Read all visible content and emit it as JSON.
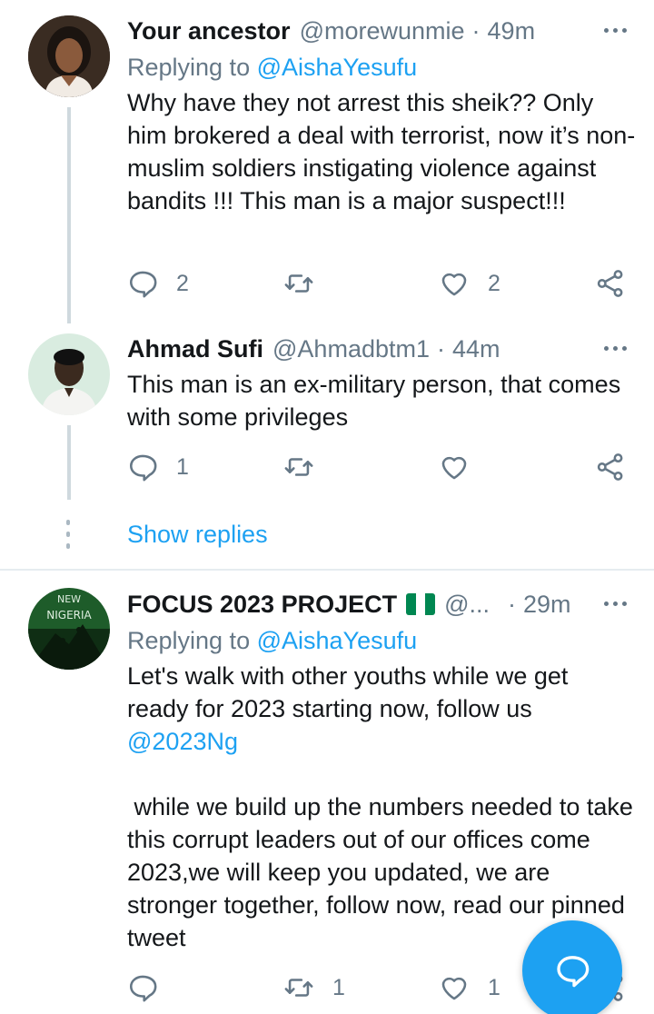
{
  "tweets": [
    {
      "name": "Your ancestor",
      "handle": "@morewunmie",
      "time": "49m",
      "replying_label": "Replying to",
      "replying_to": "@AishaYesufu",
      "text": "Why have they not arrest this sheik?? Only him brokered a deal with terrorist, now it’s non-muslim soldiers instigating violence against bandits !!! This man is a major suspect!!!",
      "reply_count": "2",
      "retweet_count": "",
      "like_count": "2"
    },
    {
      "name": "Ahmad Sufi",
      "handle": "@Ahmadbtm1",
      "time": "44m",
      "text": "This man is an ex-military person, that comes with some privileges",
      "reply_count": "1",
      "retweet_count": "",
      "like_count": ""
    },
    {
      "name": "FOCUS 2023 PROJECT",
      "handle": "@...",
      "time": "29m",
      "replying_label": "Replying to",
      "replying_to": "@AishaYesufu",
      "text_p1": "Let's walk with other youths while we get ready for 2023 starting now, follow us",
      "text_mention": "@2023Ng",
      "text_p2": " while we build up the numbers needed to take this corrupt leaders out of our offices come 2023,we will keep you updated, we are stronger together, follow now, read our pinned tweet",
      "reply_count": "",
      "retweet_count": "1",
      "like_count": "1",
      "avatar_text": [
        "NEW",
        "NIGERIA"
      ]
    }
  ],
  "show_replies": "Show replies",
  "colors": {
    "accent": "#1da1f2",
    "muted": "#657786",
    "thread": "#cfd9de",
    "flag_green": "#008751"
  },
  "icons": [
    "reply-icon",
    "retweet-icon",
    "like-icon",
    "share-icon",
    "more-icon",
    "compose-icon",
    "nigeria-flag-icon"
  ]
}
